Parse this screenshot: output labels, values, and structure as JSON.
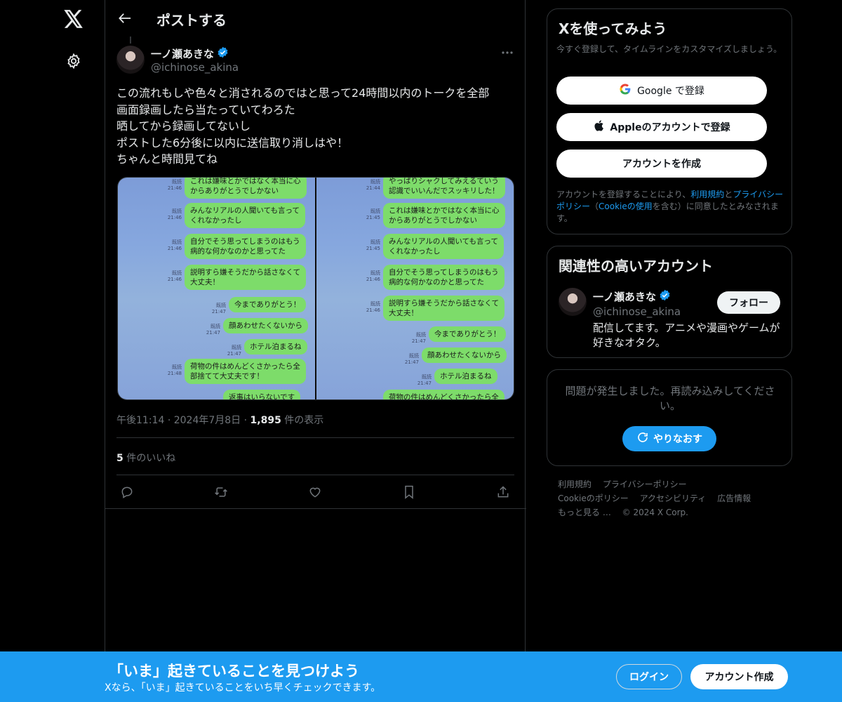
{
  "topbar": {
    "title": "ポストする"
  },
  "post": {
    "author_name": "一ノ瀬あきな",
    "author_handle": "@ichinose_akina",
    "text_lines": [
      "この流れもしや色々と消されるのではと思って24時間以内のトークを全部",
      "画面録画したら当たっていてわろた",
      "晒してから録画してないし",
      "ポストした6分後に以内に送信取り消しはや！",
      "ちゃんと時間見てね"
    ],
    "time": "午後11:14",
    "date": "2024年7月8日",
    "views_count": "1,895",
    "views_label": " 件の表示",
    "likes_count": "5",
    "likes_label": " 件のいいね"
  },
  "media": {
    "left": [
      {
        "text": "これは嫌味とかではなく本当に心\nからありがとうでしかない",
        "stamp": "既読\n21:46"
      },
      {
        "text": "みんなリアルの人聞いても言って\nくれなかったし",
        "stamp": "既読\n21:46"
      },
      {
        "text": "自分でそう思ってしまうのはもう\n病的な何かなのかと思ってた",
        "stamp": "既読\n21:46"
      },
      {
        "text": "説明すら嫌そうだから話さなくて\n大丈夫！",
        "stamp": "既読\n21:46"
      },
      {
        "text": "今までありがとう！",
        "stamp": "既読\n21:47"
      },
      {
        "text": "顔あわせたくないから",
        "stamp": "既読\n21:47"
      },
      {
        "text": "ホテル泊まるね",
        "stamp": "既読\n21:47"
      },
      {
        "text": "荷物の件はめんどくさかったら全\n部捨てて大丈夫です！",
        "stamp": "既読\n21:48"
      },
      {
        "text": "返事はいらないです",
        "stamp": ""
      }
    ],
    "right": [
      {
        "text": "やっぱりシャクしてみえるていう\n認識でいいんだでスッキリした！",
        "stamp": "既読\n21:44"
      },
      {
        "text": "これは嫌味とかではなく本当に心\nからありがとうでしかない",
        "stamp": "既読\n21:45"
      },
      {
        "text": "みんなリアルの人聞いても言って\nくれなかったし",
        "stamp": "既読\n21:45"
      },
      {
        "text": "自分でそう思ってしまうのはもう\n病的な何かなのかと思ってた",
        "stamp": "既読\n21:46"
      },
      {
        "text": "説明すら嫌そうだから話さなくて\n大丈夫！",
        "stamp": "既読\n21:46"
      },
      {
        "text": "今までありがとう！",
        "stamp": "既読\n21:47"
      },
      {
        "text": "顔あわせたくないから",
        "stamp": "既読\n21:47"
      },
      {
        "text": "ホテル泊まるね",
        "stamp": "既読\n21:47"
      },
      {
        "text": "荷物の件はめんどくさかったら全",
        "stamp": ""
      }
    ]
  },
  "signup_card": {
    "title": "Xを使ってみよう",
    "subtitle": "今すぐ登録して、タイムラインをカスタマイズしましょう。",
    "google_label": "Google で登録",
    "apple_label": "Appleのアカウントで登録",
    "create_label": "アカウントを作成",
    "legal_prefix": "アカウントを登録することにより、",
    "legal_terms": "利用規約",
    "legal_and": "と",
    "legal_privacy": "プライバシーポリシー",
    "legal_paren_open": "（",
    "legal_cookie": "Cookieの使用",
    "legal_suffix": "を含む）に同意したとみなされます。"
  },
  "related_card": {
    "title": "関連性の高いアカウント",
    "name": "一ノ瀬あきな",
    "handle": "@ichinose_akina",
    "bio": "配信してます。アニメや漫画やゲームが好きなオタク。",
    "follow_label": "フォロー"
  },
  "error_card": {
    "message": "問題が発生しました。再読み込みしてください。",
    "retry_label": "やりなおす"
  },
  "footer": {
    "terms": "利用規約",
    "privacy": "プライバシーポリシー",
    "cookie": "Cookieのポリシー",
    "accessibility": "アクセシビリティ",
    "ads": "広告情報",
    "more": "もっと見る …",
    "copyright": "© 2024 X Corp."
  },
  "banner": {
    "title": "「いま」起きていることを見つけよう",
    "subtitle": "Xなら、「いま」起きていることをいち早くチェックできます。",
    "login_label": "ログイン",
    "signup_label": "アカウント作成"
  },
  "colors": {
    "accent": "#1d9bf0",
    "border": "#2f3336",
    "muted": "#71767b",
    "bubble": "#7ddc6a"
  }
}
